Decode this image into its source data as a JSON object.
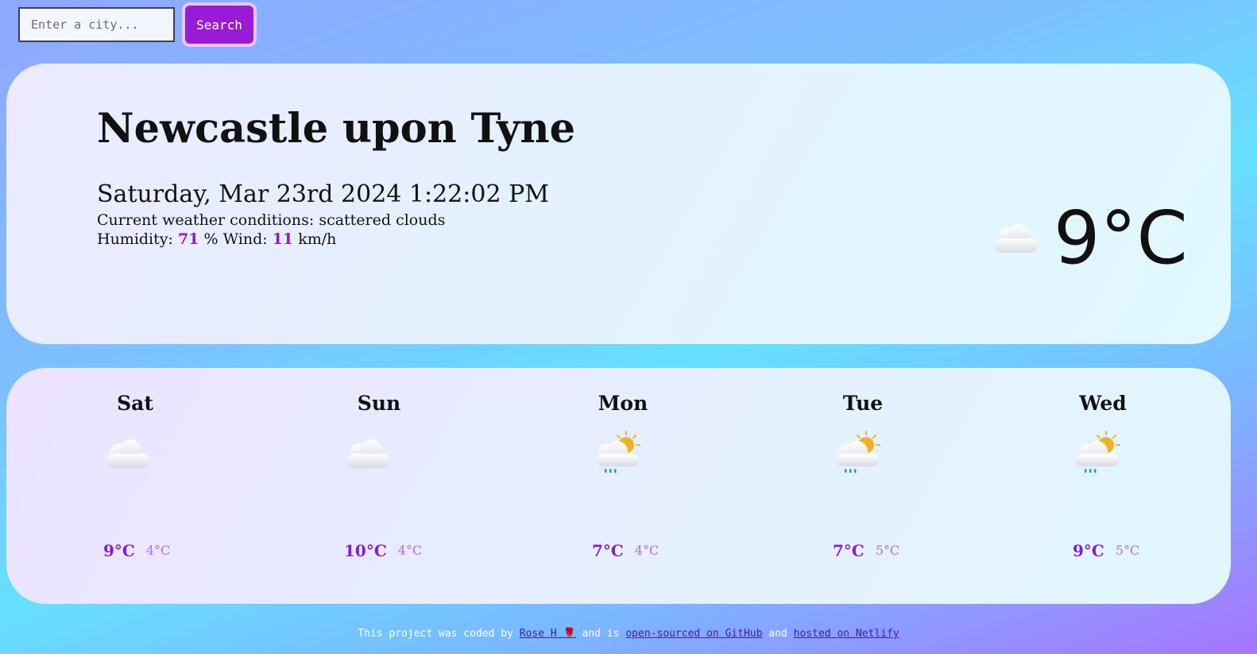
{
  "search": {
    "placeholder": "Enter a city...",
    "button_label": "Search"
  },
  "current": {
    "city": "Newcastle upon Tyne",
    "datetime": "Saturday, Mar 23rd 2024 1:22:02 PM",
    "conditions_label": "Current weather conditions:",
    "conditions": "scattered clouds",
    "humidity_label": "Humidity:",
    "humidity": "71",
    "humidity_unit": "%",
    "wind_label": "Wind:",
    "wind": "11",
    "wind_unit": "km/h",
    "temperature": "9°C",
    "icon": "cloud-icon"
  },
  "forecast": [
    {
      "day": "Sat",
      "max": "9°C",
      "min": "4°C",
      "icon": "cloud-icon"
    },
    {
      "day": "Sun",
      "max": "10°C",
      "min": "4°C",
      "icon": "cloud-icon"
    },
    {
      "day": "Mon",
      "max": "7°C",
      "min": "4°C",
      "icon": "sun-rain-cloud-icon"
    },
    {
      "day": "Tue",
      "max": "7°C",
      "min": "5°C",
      "icon": "sun-rain-cloud-icon"
    },
    {
      "day": "Wed",
      "max": "9°C",
      "min": "5°C",
      "icon": "sun-rain-cloud-icon"
    }
  ],
  "footer": {
    "text1": "This project was coded by",
    "author": "Rose H",
    "author_emoji": "🌹",
    "text2": "and is",
    "github": "open-sourced on GitHub",
    "text3": "and",
    "netlify": "hosted on Netlify"
  },
  "colors": {
    "accent": "#8a1ad0",
    "button": "#9a1bd6",
    "min_temp": "#b06ee6"
  }
}
